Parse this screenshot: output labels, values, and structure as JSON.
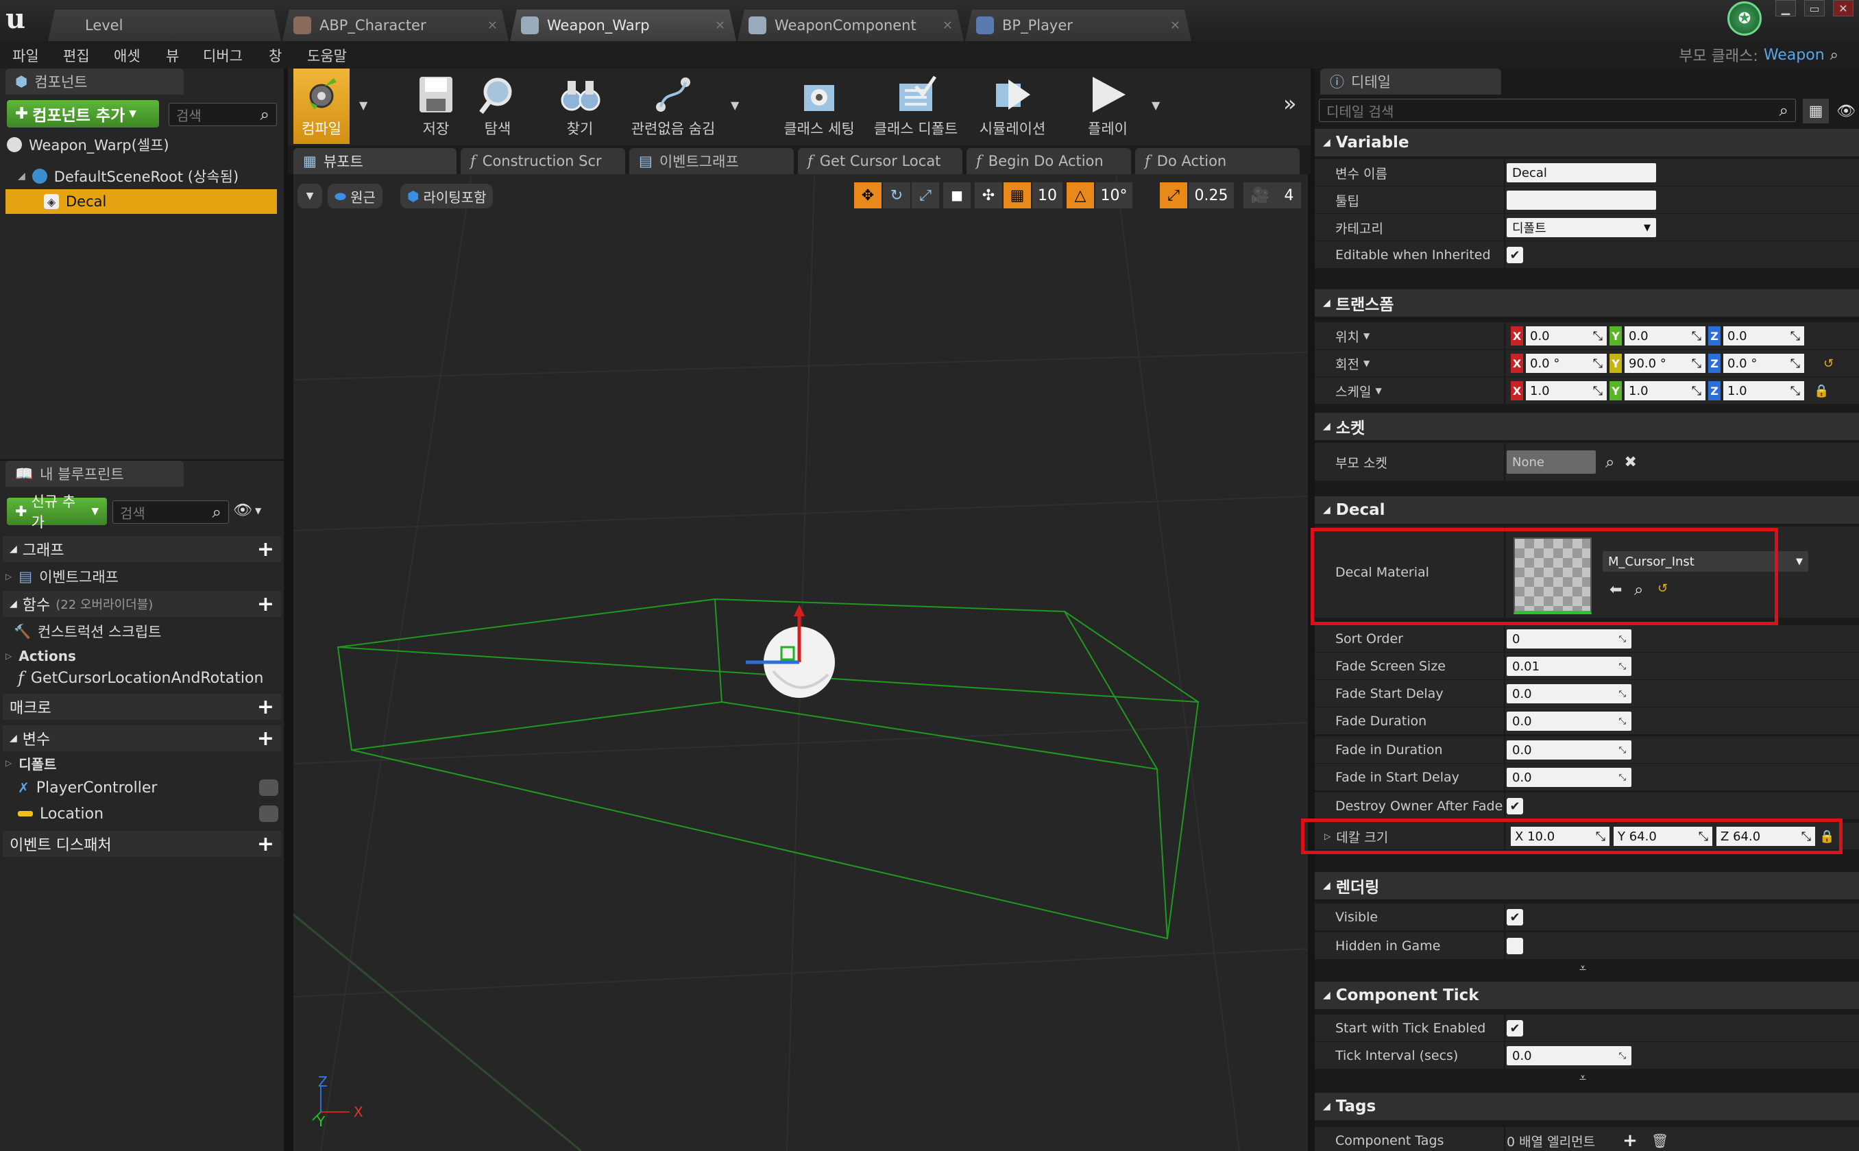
{
  "tabs": [
    {
      "label": "Level"
    },
    {
      "label": "ABP_Character"
    },
    {
      "label": "Weapon_Warp"
    },
    {
      "label": "WeaponComponent"
    },
    {
      "label": "BP_Player"
    }
  ],
  "menu": [
    "파일",
    "편집",
    "애셋",
    "뷰",
    "디버그",
    "창",
    "도움말"
  ],
  "parent_class": {
    "label": "부모 클래스:",
    "value": "Weapon"
  },
  "components": {
    "tab": "컴포넌트",
    "add_button": "컴포넌트 추가",
    "search_placeholder": "검색",
    "self_label": "Weapon_Warp(셀프)",
    "root_label": "DefaultSceneRoot (상속됨)",
    "decal_label": "Decal"
  },
  "my_blueprint": {
    "tab": "내 블루프린트",
    "add_button": "신규 추가",
    "search_placeholder": "검색",
    "graph": "그래프",
    "event_graph": "이벤트그래프",
    "functions": "함수",
    "functions_override": "(22 오버라이더블)",
    "construction": "컨스트럭션 스크립트",
    "actions": "Actions",
    "get_cursor": "GetCursorLocationAndRotation",
    "macro": "매크로",
    "variables": "변수",
    "default": "디폴트",
    "var_pc": "PlayerController",
    "var_loc": "Location",
    "dispatcher": "이벤트 디스패처"
  },
  "toolbar": {
    "compile": "컴파일",
    "save": "저장",
    "browse": "탐색",
    "find": "찾기",
    "hide": "관련없음 숨김",
    "class_settings": "클래스 세팅",
    "class_defaults": "클래스 디폴트",
    "simulation": "시뮬레이션",
    "play": "플레이"
  },
  "graph_tabs": [
    "뷰포트",
    "Construction Scr",
    "이벤트그래프",
    "Get Cursor Locat",
    "Begin Do Action",
    "Do Action"
  ],
  "viewport": {
    "perspective": "원근",
    "lit": "라이팅포함",
    "grid_snap": "10",
    "rot_snap": "10°",
    "scale_snap": "0.25",
    "cam_speed": "4",
    "axis_x": "X",
    "axis_y": "Y",
    "axis_z": "Z"
  },
  "details": {
    "tab": "디테일",
    "search_placeholder": "디테일 검색",
    "variable": {
      "title": "Variable",
      "name_label": "변수 이름",
      "name_value": "Decal",
      "tooltip_label": "툴팁",
      "tooltip_value": "",
      "category_label": "카테고리",
      "category_value": "디폴트",
      "editable_label": "Editable when Inherited"
    },
    "transform": {
      "title": "트랜스폼",
      "location_label": "위치",
      "location": [
        "0.0",
        "0.0",
        "0.0"
      ],
      "rotation_label": "회전",
      "rotation": [
        "0.0 °",
        "90.0 °",
        "0.0 °"
      ],
      "scale_label": "스케일",
      "scale": [
        "1.0",
        "1.0",
        "1.0"
      ]
    },
    "socket": {
      "title": "소켓",
      "parent_label": "부모 소켓",
      "parent_value": "None"
    },
    "decal": {
      "title": "Decal",
      "material_label": "Decal Material",
      "material_value": "M_Cursor_Inst",
      "sort_order_label": "Sort Order",
      "sort_order": "0",
      "fade_screen_label": "Fade Screen Size",
      "fade_screen": "0.01",
      "fade_start_label": "Fade Start Delay",
      "fade_start": "0.0",
      "fade_duration_label": "Fade Duration",
      "fade_duration": "0.0",
      "fade_in_duration_label": "Fade in Duration",
      "fade_in_duration": "0.0",
      "fade_in_start_label": "Fade in Start Delay",
      "fade_in_start": "0.0",
      "destroy_label": "Destroy Owner After Fade",
      "size_label": "데칼 크기",
      "size": [
        "10.0",
        "64.0",
        "64.0"
      ]
    },
    "rendering": {
      "title": "렌더링",
      "visible_label": "Visible",
      "hidden_label": "Hidden in Game"
    },
    "tick": {
      "title": "Component Tick",
      "start_label": "Start with Tick Enabled",
      "interval_label": "Tick Interval (secs)",
      "interval": "0.0"
    },
    "tags": {
      "title": "Tags",
      "component_tags_label": "Component Tags",
      "component_tags_value": "0 배열 엘리먼트"
    }
  }
}
